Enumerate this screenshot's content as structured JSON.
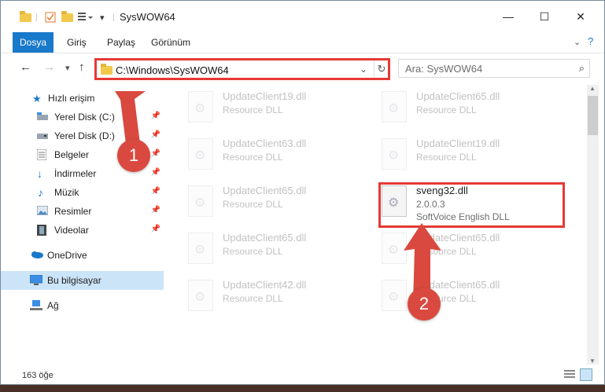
{
  "window": {
    "title": "SysWOW64"
  },
  "ribbon": {
    "tabs": [
      "Dosya",
      "Giriş",
      "Paylaş",
      "Görünüm"
    ]
  },
  "address": {
    "path": "C:\\Windows\\SysWOW64"
  },
  "search": {
    "placeholder": "Ara: SysWOW64"
  },
  "sidebar": {
    "items": [
      {
        "label": "Hızlı erişim",
        "icon": "star-icon",
        "pinned": false
      },
      {
        "label": "Yerel Disk (C:)",
        "icon": "drive-icon",
        "pinned": true
      },
      {
        "label": "Yerel Disk (D:)",
        "icon": "drive-icon",
        "pinned": true
      },
      {
        "label": "Belgeler",
        "icon": "documents-icon",
        "pinned": true
      },
      {
        "label": "İndirmeler",
        "icon": "download-icon",
        "pinned": true
      },
      {
        "label": "Müzik",
        "icon": "music-icon",
        "pinned": true
      },
      {
        "label": "Resimler",
        "icon": "pictures-icon",
        "pinned": true
      },
      {
        "label": "Videolar",
        "icon": "video-icon",
        "pinned": true
      },
      {
        "label": "OneDrive",
        "icon": "cloud-icon",
        "pinned": false
      },
      {
        "label": "Bu bilgisayar",
        "icon": "computer-icon",
        "pinned": false
      },
      {
        "label": "Ağ",
        "icon": "network-icon",
        "pinned": false
      }
    ]
  },
  "files": [
    {
      "name": "UpdateClient19.dll",
      "desc": "Resource DLL",
      "version": ""
    },
    {
      "name": "UpdateClient65.dll",
      "desc": "Resource DLL",
      "version": ""
    },
    {
      "name": "UpdateClient63.dll",
      "desc": "Resource DLL",
      "version": ""
    },
    {
      "name": "UpdateClient19.dll",
      "desc": "Resource DLL",
      "version": ""
    },
    {
      "name": "UpdateClient65.dll",
      "desc": "Resource DLL",
      "version": ""
    },
    {
      "name": "sveng32.dll",
      "desc": "SoftVoice English DLL",
      "version": "2.0.0.3"
    },
    {
      "name": "UpdateClient65.dll",
      "desc": "Resource DLL",
      "version": ""
    },
    {
      "name": "UpdateClient65.dll",
      "desc": "Resource DLL",
      "version": ""
    },
    {
      "name": "UpdateClient42.dll",
      "desc": "Resource DLL",
      "version": ""
    },
    {
      "name": "UpdateClient65.dll",
      "desc": "Resource DLL",
      "version": ""
    }
  ],
  "status": {
    "count": "163 öğe"
  },
  "annotations": {
    "step1": "1",
    "step2": "2"
  },
  "colors": {
    "accent": "#1979ca",
    "highlight": "#e53935",
    "badge": "#d9493f"
  }
}
